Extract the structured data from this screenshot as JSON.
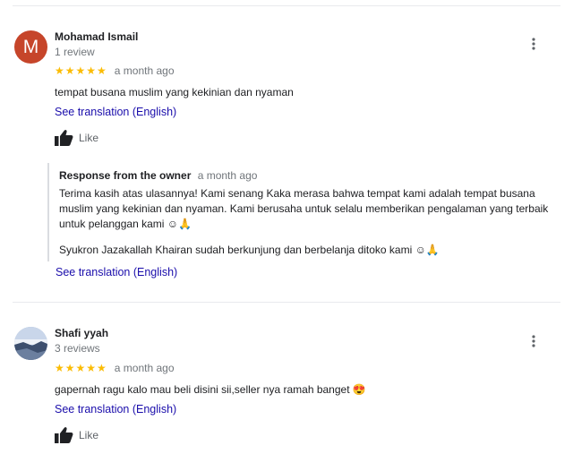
{
  "reviews": [
    {
      "name": "Mohamad Ismail",
      "meta": "1 review",
      "avatar_letter": "M",
      "avatar_color": "#c6452a",
      "rating": 5,
      "stars": "★★★★★",
      "time": "a month ago",
      "text": "tempat busana muslim yang kekinian dan nyaman",
      "translate": "See translation (English)",
      "like": "Like",
      "response": {
        "title": "Response from the owner",
        "time": "a month ago",
        "text": "Terima kasih atas ulasannya! Kami senang Kaka merasa bahwa tempat kami adalah tempat busana muslim yang kekinian dan nyaman. Kami berusaha untuk selalu memberikan pengalaman yang terbaik untuk pelanggan kami ☺🙏",
        "text2": "Syukron Jazakallah Khairan sudah berkunjung dan berbelanja ditoko kami ☺🙏",
        "translate": "See translation (English)"
      }
    },
    {
      "name": "Shafi yyah",
      "meta": "3 reviews",
      "avatar_icon": "landscape-photo-avatar",
      "rating": 5,
      "stars": "★★★★★",
      "time": "a month ago",
      "text": "gapernah ragu kalo mau beli disini sii,seller nya ramah banget 😍",
      "translate": "See translation (English)",
      "like": "Like"
    }
  ],
  "icons": {
    "like": "thumbs-up-icon",
    "more": "more-vert-icon"
  },
  "colors": {
    "star": "#fbbc04",
    "link": "#1a0dab",
    "muted": "#70757a"
  }
}
